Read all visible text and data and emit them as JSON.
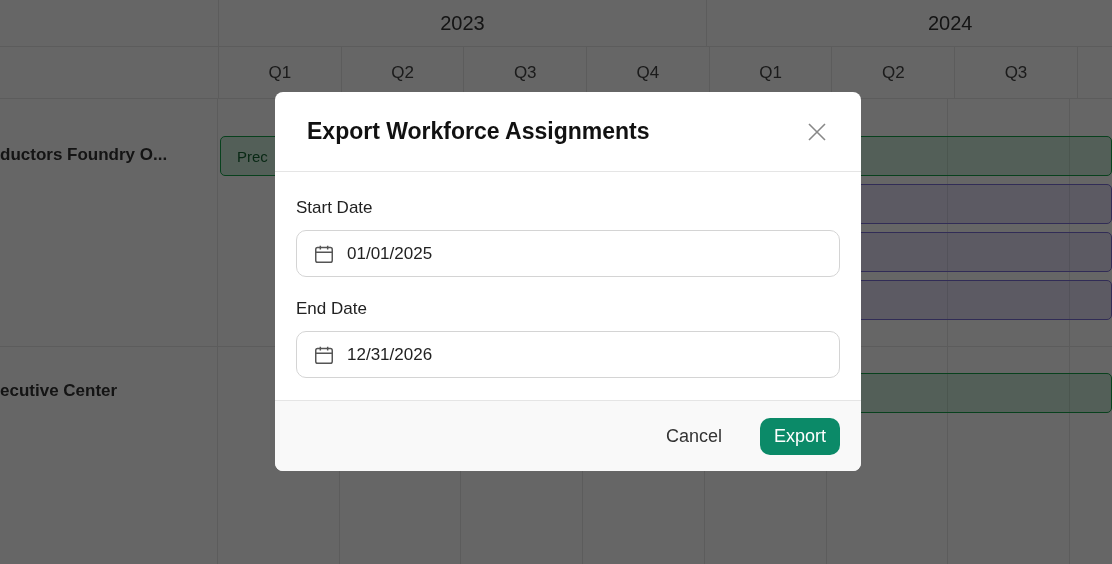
{
  "timeline": {
    "years": [
      {
        "label": "2023"
      },
      {
        "label": "2024"
      }
    ],
    "quarters": [
      {
        "label": "Q1"
      },
      {
        "label": "Q2"
      },
      {
        "label": "Q3"
      },
      {
        "label": "Q4"
      },
      {
        "label": "Q1"
      },
      {
        "label": "Q2"
      },
      {
        "label": "Q3"
      }
    ],
    "rows": [
      {
        "label": "ductors Foundry O...",
        "bars": [
          {
            "label": "Prec",
            "kind": "site"
          },
          {
            "kind": "assignment"
          },
          {
            "kind": "assignment"
          },
          {
            "kind": "assignment"
          }
        ]
      },
      {
        "label": "ecutive Center",
        "bars": [
          {
            "kind": "site"
          }
        ]
      }
    ]
  },
  "dialog": {
    "title": "Export Workforce Assignments",
    "fields": [
      {
        "label": "Start Date",
        "value": "01/01/2025"
      },
      {
        "label": "End Date",
        "value": "12/31/2026"
      }
    ],
    "buttons": [
      {
        "label": "Cancel",
        "kind": "secondary"
      },
      {
        "label": "Export",
        "kind": "primary"
      }
    ]
  }
}
